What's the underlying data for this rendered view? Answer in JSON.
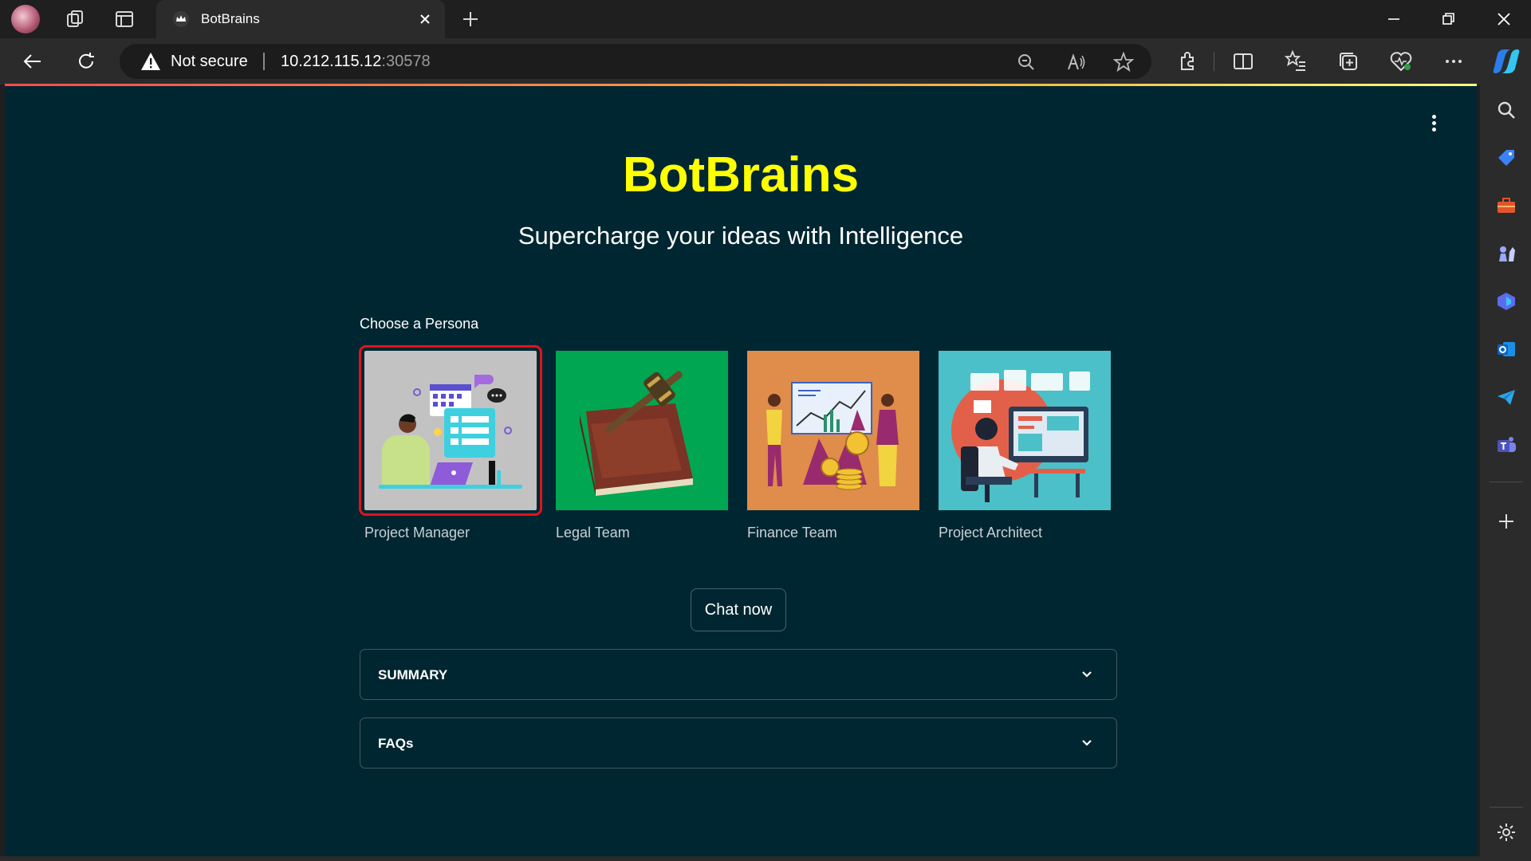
{
  "browser": {
    "tab": {
      "title": "BotBrains"
    },
    "address": {
      "security_label": "Not secure",
      "host": "10.212.115.12",
      "port": ":30578"
    }
  },
  "app": {
    "title": "BotBrains",
    "subtitle": "Supercharge your ideas with Intelligence",
    "persona_label": "Choose a Persona",
    "personas": [
      {
        "label": "Project Manager",
        "selected": true,
        "bg": "#c2c2c2"
      },
      {
        "label": "Legal Team",
        "selected": false,
        "bg": "#00a651"
      },
      {
        "label": "Finance Team",
        "selected": false,
        "bg": "#e08c4b"
      },
      {
        "label": "Project Architect",
        "selected": false,
        "bg": "#4bc0c8"
      }
    ],
    "chat_button": "Chat now",
    "expanders": [
      {
        "label": "SUMMARY"
      },
      {
        "label": "FAQs"
      }
    ]
  },
  "colors": {
    "page_bg": "#002631",
    "title": "#ffff00",
    "selected_outline": "#e0141e"
  }
}
